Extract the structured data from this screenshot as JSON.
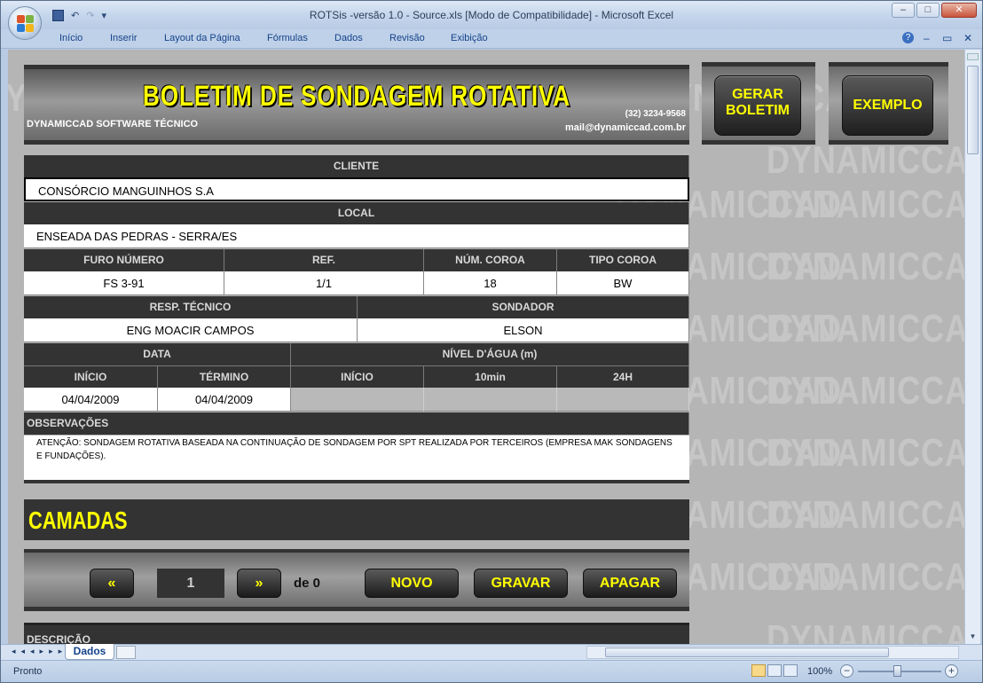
{
  "window": {
    "title": "ROTSis -versão 1.0 - Source.xls  [Modo de Compatibilidade] - Microsoft Excel",
    "minimize": "–",
    "maximize": "□",
    "close": "✕"
  },
  "ribbon": {
    "tabs": [
      "Início",
      "Inserir",
      "Layout da Página",
      "Fórmulas",
      "Dados",
      "Revisão",
      "Exibição"
    ],
    "help": "?",
    "min": "–",
    "restore": "▭",
    "close": "✕"
  },
  "watermark": "DYNAMICCAD",
  "banner": {
    "title": "BOLETIM DE SONDAGEM  ROTATIVA",
    "company": "DYNAMICCAD SOFTWARE TÉCNICO",
    "phone": "(32) 3234-9568",
    "email": "mail@dynamiccad.com.br"
  },
  "buttons": {
    "gerar_line1": "GERAR",
    "gerar_line2": "BOLETIM",
    "exemplo": "EXEMPLO"
  },
  "form": {
    "cliente_label": "CLIENTE",
    "cliente_value": "CONSÓRCIO MANGUINHOS S.A",
    "local_label": "LOCAL",
    "local_value": "ENSEADA DAS PEDRAS - SERRA/ES",
    "furo_label": "FURO NÚMERO",
    "furo_value": "FS 3-91",
    "ref_label": "REF.",
    "ref_value": "1/1",
    "coroa_num_label": "NÚM. COROA",
    "coroa_num_value": "18",
    "coroa_tipo_label": "TIPO COROA",
    "coroa_tipo_value": "BW",
    "resp_label": "RESP. TÉCNICO",
    "resp_value": "ENG MOACIR CAMPOS",
    "sondador_label": "SONDADOR",
    "sondador_value": "ELSON",
    "data_label": "DATA",
    "nivel_label": "NÍVEL D'ÁGUA (m)",
    "inicio_label": "INÍCIO",
    "termino_label": "TÉRMINO",
    "nivel_inicio_label": "INÍCIO",
    "nivel_10min_label": "10min",
    "nivel_24h_label": "24H",
    "inicio_value": "04/04/2009",
    "termino_value": "04/04/2009",
    "obs_label": "OBSERVAÇÕES",
    "obs_text": "ATENÇÃO: SONDAGEM ROTATIVA BASEADA NA CONTINUAÇÃO DE SONDAGEM POR SPT REALIZADA POR TERCEIROS (EMPRESA MAK SONDAGENS E FUNDAÇÕES)."
  },
  "camadas": {
    "title": "CAMADAS",
    "prev": "«",
    "page": "1",
    "next": "»",
    "of_text": "de 0",
    "novo": "NOVO",
    "gravar": "GRAVAR",
    "apagar": "APAGAR",
    "descricao_label": "DESCRIÇÃO"
  },
  "sheet_tabs": {
    "nav": "◂◂◂▸▸▸",
    "active": "Dados"
  },
  "status": {
    "ready": "Pronto",
    "zoom": "100%",
    "zoom_out": "−",
    "zoom_in": "+"
  }
}
